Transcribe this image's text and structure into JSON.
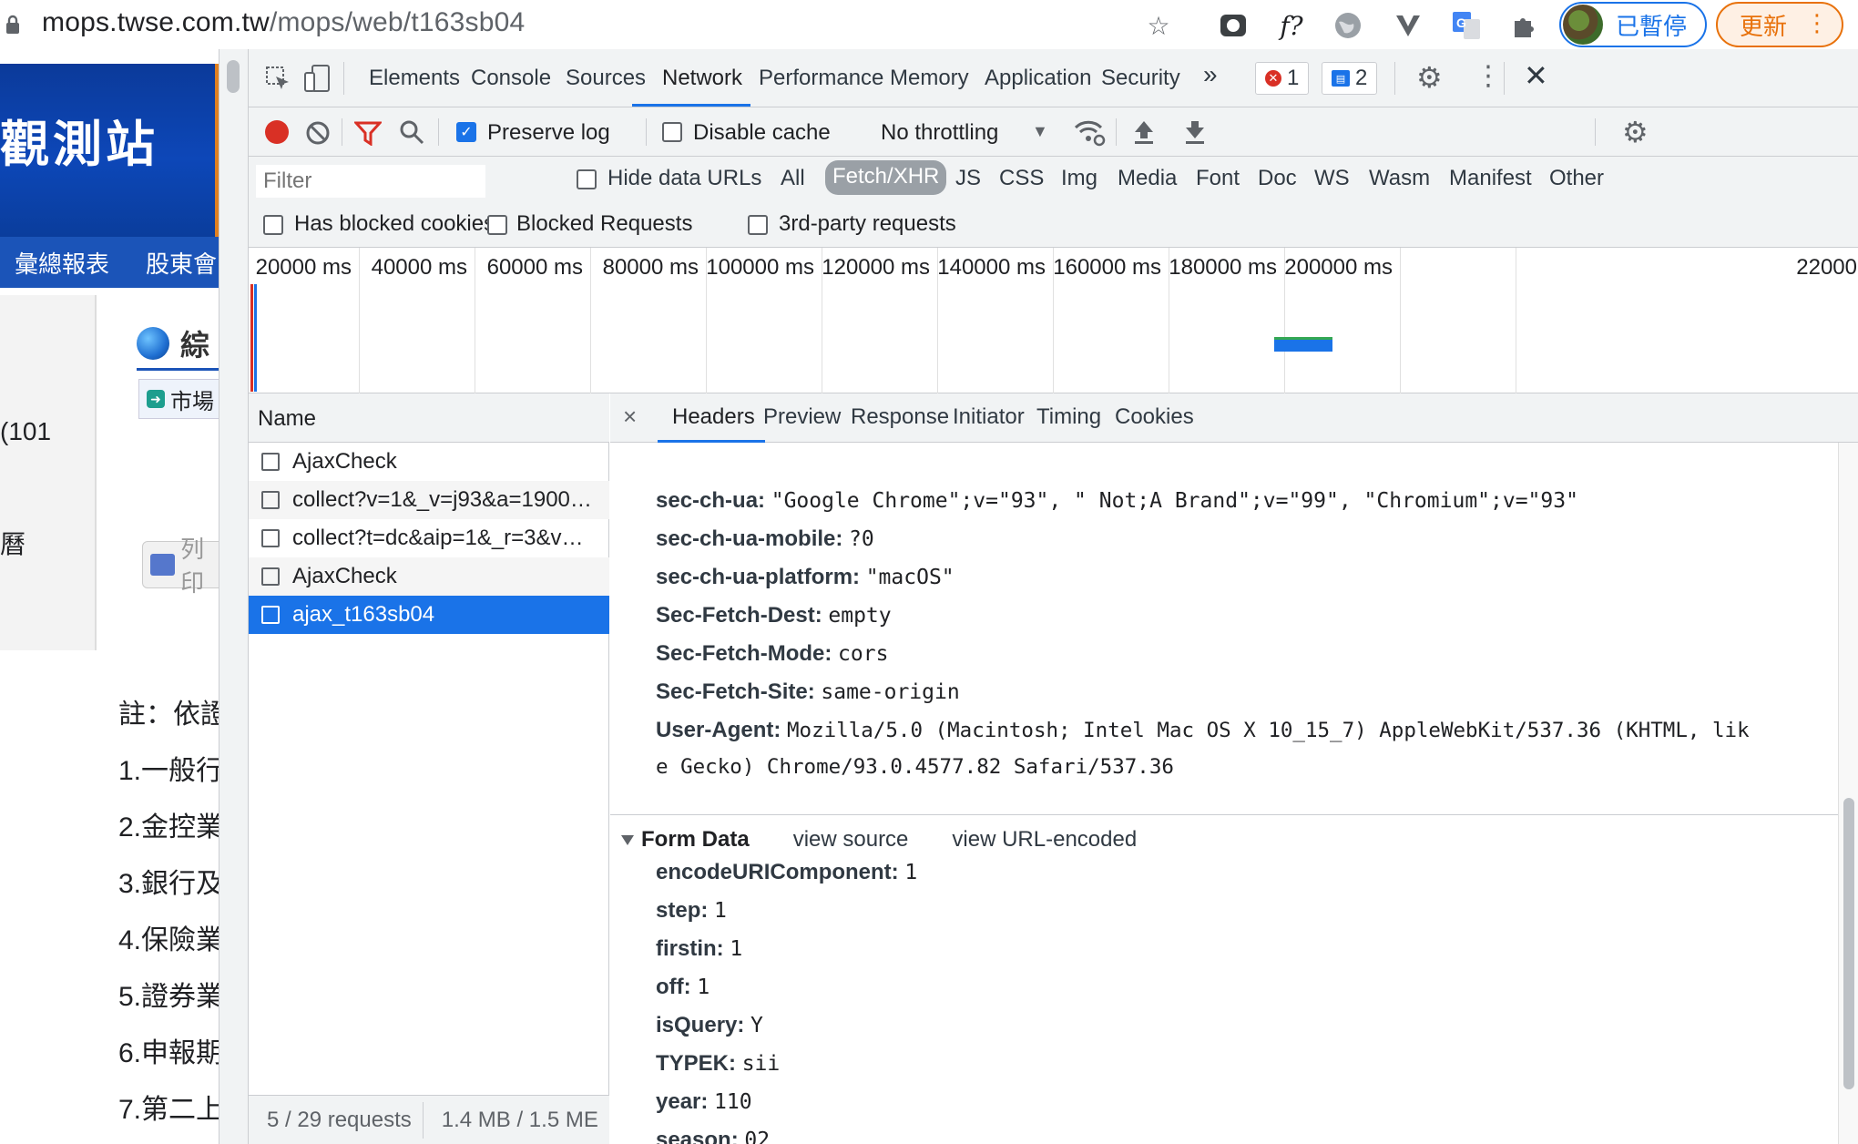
{
  "browser": {
    "url_host": "mops.twse.com.tw",
    "url_path": "/mops/web/t163sb04",
    "profile_label": "已暫停",
    "update_label": "更新",
    "icons": [
      "lock-icon",
      "bookmark-star-icon",
      "extension-icon",
      "fx-extension-icon",
      "globe-extension-icon",
      "v-extension-icon",
      "translate-icon",
      "puzzle-icon",
      "menu-dots-icon"
    ]
  },
  "page": {
    "banner_title": "觀測站",
    "nav_items": [
      "彙總報表",
      "股東會"
    ],
    "section_title": "綜",
    "market_label": "市場",
    "side_text_1": "(101",
    "side_text_2": "曆",
    "print_label": "列印",
    "notes": [
      "註：依證",
      "1.一般行",
      "2.金控業",
      "3.銀行及",
      "4.保險業",
      "5.證券業",
      "6.申報期",
      "7.第二上"
    ]
  },
  "devtools": {
    "tabs": [
      "Elements",
      "Console",
      "Sources",
      "Network",
      "Performance",
      "Memory",
      "Application",
      "Security"
    ],
    "active_tab": "Network",
    "more_label": "»",
    "error_count": "1",
    "message_count": "2",
    "toolbar": {
      "preserve_log": "Preserve log",
      "disable_cache": "Disable cache",
      "throttling": "No throttling"
    },
    "filter": {
      "placeholder": "Filter",
      "hide_data_urls": "Hide data URLs",
      "types": [
        "All",
        "Fetch/XHR",
        "JS",
        "CSS",
        "Img",
        "Media",
        "Font",
        "Doc",
        "WS",
        "Wasm",
        "Manifest",
        "Other"
      ],
      "active_type": "Fetch/XHR",
      "has_blocked_cookies": "Has blocked cookies",
      "blocked_requests": "Blocked Requests",
      "third_party": "3rd-party requests"
    },
    "overview_ticks": [
      "20000 ms",
      "40000 ms",
      "60000 ms",
      "80000 ms",
      "100000 ms",
      "120000 ms",
      "140000 ms",
      "160000 ms",
      "180000 ms",
      "200000 ms",
      "22000"
    ],
    "requests": {
      "column": "Name",
      "rows": [
        "AjaxCheck",
        "collect?v=1&_v=j93&a=1900…",
        "collect?t=dc&aip=1&_r=3&v…",
        "AjaxCheck",
        "ajax_t163sb04"
      ],
      "selected_index": 4,
      "status_count": "5 / 29 requests",
      "status_size": "1.4 MB / 1.5 ME"
    },
    "detail": {
      "close": "×",
      "tabs": [
        "Headers",
        "Preview",
        "Response",
        "Initiator",
        "Timing",
        "Cookies"
      ],
      "active_tab": "Headers",
      "headers": [
        {
          "key": "sec-ch-ua:",
          "value": "\"Google Chrome\";v=\"93\", \" Not;A Brand\";v=\"99\", \"Chromium\";v=\"93\""
        },
        {
          "key": "sec-ch-ua-mobile:",
          "value": "?0"
        },
        {
          "key": "sec-ch-ua-platform:",
          "value": "\"macOS\""
        },
        {
          "key": "Sec-Fetch-Dest:",
          "value": "empty"
        },
        {
          "key": "Sec-Fetch-Mode:",
          "value": "cors"
        },
        {
          "key": "Sec-Fetch-Site:",
          "value": "same-origin"
        },
        {
          "key": "User-Agent:",
          "value": "Mozilla/5.0 (Macintosh; Intel Mac OS X 10_15_7) AppleWebKit/537.36 (KHTML, lik"
        }
      ],
      "user_agent_cont": "e Gecko) Chrome/93.0.4577.82 Safari/537.36",
      "form_title": "Form Data",
      "view_source": "view source",
      "view_url_encoded": "view URL-encoded",
      "form_data": [
        {
          "key": "encodeURIComponent:",
          "value": "1"
        },
        {
          "key": "step:",
          "value": "1"
        },
        {
          "key": "firstin:",
          "value": "1"
        },
        {
          "key": "off:",
          "value": "1"
        },
        {
          "key": "isQuery:",
          "value": "Y"
        },
        {
          "key": "TYPEK:",
          "value": "sii"
        },
        {
          "key": "year:",
          "value": "110"
        },
        {
          "key": "season:",
          "value": "02"
        }
      ]
    }
  }
}
